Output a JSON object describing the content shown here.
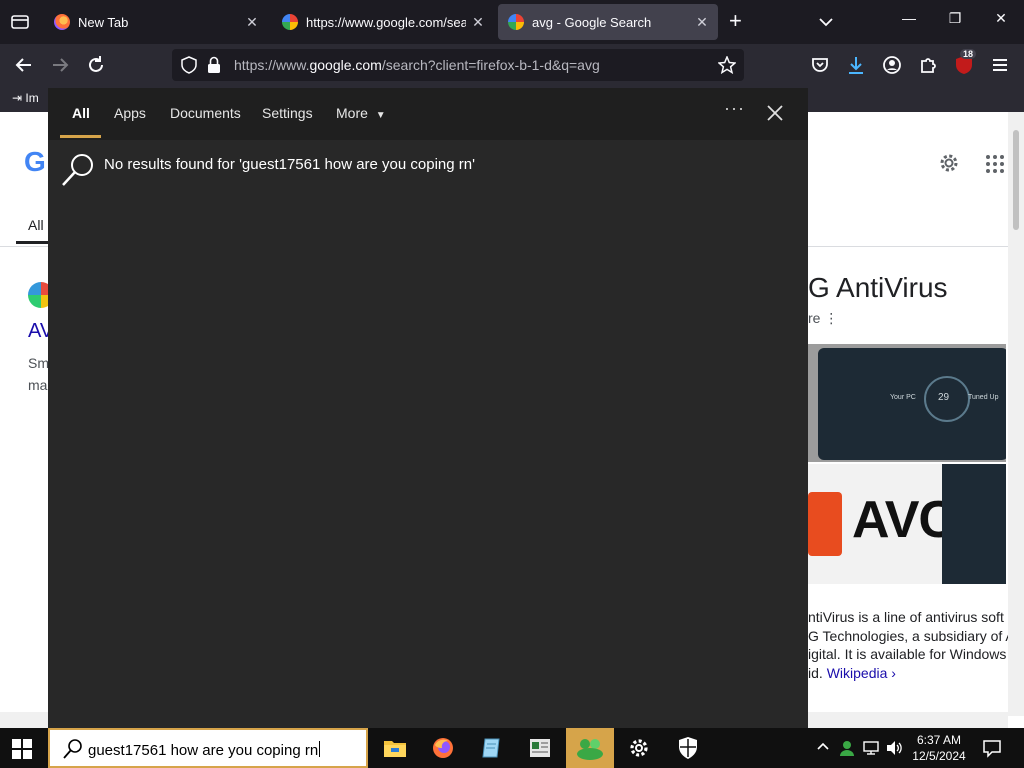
{
  "browser": {
    "tabs": [
      {
        "title": "New Tab",
        "active": false,
        "icon": "firefox-icon"
      },
      {
        "title": "https://www.google.com/searc",
        "active": false,
        "icon": "google-icon"
      },
      {
        "title": "avg - Google Search",
        "active": true,
        "icon": "google-icon"
      }
    ],
    "url": {
      "prefix": "https://www.",
      "host": "google.com",
      "suffix": "/search?client=firefox-b-1-d&q=avg"
    },
    "extension_badge": "18",
    "bookmark_label": "Im"
  },
  "google_page": {
    "logo_letter": "G",
    "tab_all": "All",
    "result_title": "AV",
    "result_snippet_lines": [
      "Sm",
      "ma"
    ],
    "knowledge_panel": {
      "title": "G AntiVirus",
      "subtitle": "re",
      "image_text": "AVC",
      "screen_labels": [
        "Your PC",
        "29",
        "Tuned Up"
      ],
      "desc_lines": [
        "ntiVirus is a line of antivirus soft",
        "G Technologies, a subsidiary of A",
        "igital. It is available for Windows",
        "id."
      ],
      "wiki_link": "Wikipedia ›"
    }
  },
  "search_flyout": {
    "tabs": [
      "All",
      "Apps",
      "Documents",
      "Settings"
    ],
    "more_label": "More",
    "ellipsis": "···",
    "no_results_text": "No results found for 'guest17561 how are you coping rn'"
  },
  "taskbar": {
    "search_text": "guest17561 how are you coping rn",
    "apps": [
      "file-explorer-icon",
      "firefox-icon",
      "notepad-icon",
      "news-icon",
      "people-icon",
      "settings-icon",
      "security-icon"
    ],
    "clock_time": "6:37 AM",
    "clock_date": "12/5/2024"
  },
  "colors": {
    "accent": "#d6a44a",
    "flyout_bg": "#282828",
    "taskbar_bg": "#101010",
    "firefox_tabbar": "#1c1b22",
    "link_blue": "#1a0dab"
  }
}
